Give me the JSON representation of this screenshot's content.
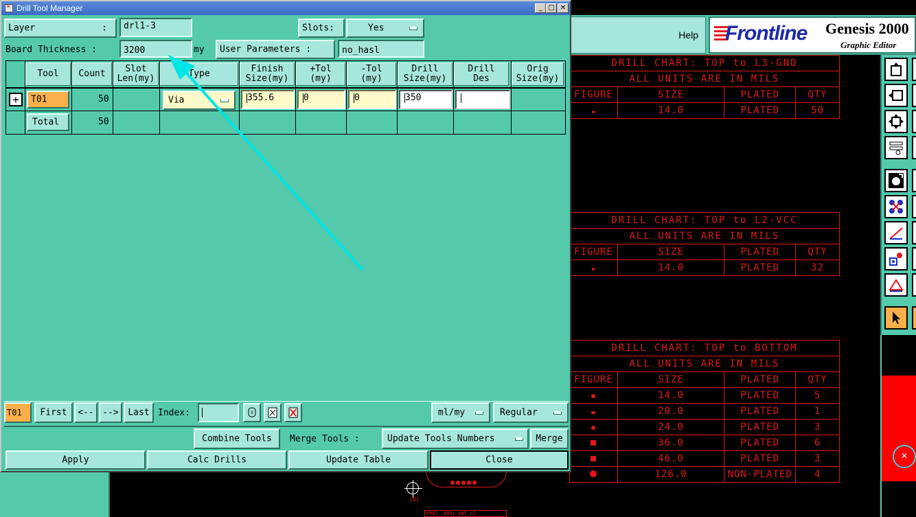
{
  "window": {
    "title": "Drill Tool Manager",
    "minimize": "_",
    "maximize": "□",
    "close": "✕"
  },
  "header": {
    "layer_label": "Layer",
    "layer_colon": ":",
    "layer_value": "drl1-3",
    "slots_label": "Slots:",
    "slots_value": "Yes",
    "board_thickness_label": "Board Thickness :",
    "board_thickness_value": "3200",
    "board_thickness_unit": "my",
    "user_params_label": "User Parameters :",
    "user_params_value": "no_hasl"
  },
  "grid": {
    "columns": [
      "Tool",
      "Count",
      "Slot\nLen(my)",
      "Type",
      "Finish\nSize(my)",
      "+Tol\n(my)",
      "-Tol\n(my)",
      "Drill\nSize(my)",
      "Drill\nDes",
      "Orig\nSize(my)"
    ],
    "row": {
      "expand": "+",
      "tool": "T01",
      "count": "50",
      "type": "Via",
      "finish_size": "355.6",
      "plus_tol": "0",
      "minus_tol": "0",
      "drill_size": "350",
      "drill_des": ""
    },
    "total": {
      "label": "Total",
      "count": "50"
    }
  },
  "nav": {
    "current_tool": "T01",
    "first": "First",
    "prev": "<--",
    "next": "-->",
    "last": "Last",
    "index_label": "Index:",
    "index_value": "",
    "units": "ml/my",
    "mode": "Regular"
  },
  "actions": {
    "combine_tools": "Combine Tools",
    "merge_tools_label": "Merge Tools :",
    "update_tools_numbers": "Update Tools Numbers",
    "merge": "Merge",
    "apply": "Apply",
    "calc_drills": "Calc Drills",
    "update_table": "Update Table",
    "close": "Close"
  },
  "genesis": {
    "help": "Help",
    "logo": "Frontline",
    "title": "Genesis 2000",
    "subtitle": "Graphic Editor"
  },
  "drill_charts": [
    {
      "title": "DRILL CHART: TOP to L3-GND",
      "units": "ALL UNITS ARE IN MILS",
      "headers": [
        "FIGURE",
        "SIZE",
        "PLATED",
        "QTY"
      ],
      "rows": [
        {
          "size": "14.0",
          "plated": "PLATED",
          "qty": "50"
        }
      ]
    },
    {
      "title": "DRILL CHART: TOP to L2-VCC",
      "units": "ALL UNITS ARE IN MILS",
      "headers": [
        "FIGURE",
        "SIZE",
        "PLATED",
        "QTY"
      ],
      "rows": [
        {
          "size": "14.0",
          "plated": "PLATED",
          "qty": "32"
        }
      ]
    },
    {
      "title": "DRILL CHART: TOP to BOTTOM",
      "units": "ALL UNITS ARE IN MILS",
      "headers": [
        "FIGURE",
        "SIZE",
        "PLATED",
        "QTY"
      ],
      "rows": [
        {
          "size": "14.0",
          "plated": "PLATED",
          "qty": "5"
        },
        {
          "size": "20.0",
          "plated": "PLATED",
          "qty": "1"
        },
        {
          "size": "24.0",
          "plated": "PLATED",
          "qty": "3"
        },
        {
          "size": "36.0",
          "plated": "PLATED",
          "qty": "6"
        },
        {
          "size": "46.0",
          "plated": "PLATED",
          "qty": "3"
        },
        {
          "size": "126.0",
          "plated": "NON-PLATED",
          "qty": "4"
        }
      ]
    }
  ],
  "pcb": {
    "label_small": "[8]",
    "label_proj": "PROJ .N99r ANT v2"
  },
  "colors": {
    "panel": "#54c9ac",
    "button": "#a6e6dc",
    "chart_red": "#e01818",
    "arrow_cyan": "#00e5e5",
    "tool_highlight": "#f9b04a"
  }
}
